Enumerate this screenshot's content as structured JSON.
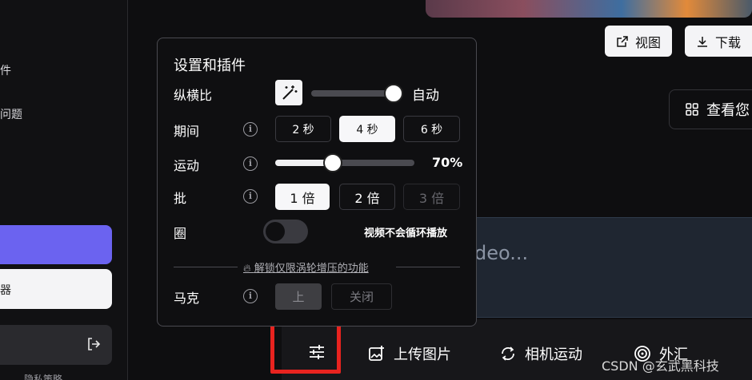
{
  "sidebar": {
    "item_a": "件",
    "item_b": "问题",
    "white_button": "器",
    "footer": "隐私策略"
  },
  "toolbar": {
    "view_label": "视图",
    "download_label": "下载",
    "gallery_label": "查看您"
  },
  "prompt": {
    "placeholder_tail": "deo..."
  },
  "settings": {
    "title": "设置和插件",
    "aspect": {
      "label": "纵横比",
      "value": "自动",
      "level": 1.0
    },
    "duration": {
      "label": "期间",
      "options": [
        "2 秒",
        "4 秒",
        "6 秒"
      ],
      "selected": "4 秒"
    },
    "motion": {
      "label": "运动",
      "value": "70%",
      "level": 0.7
    },
    "batch": {
      "label": "批",
      "options": [
        "1 倍",
        "2 倍",
        "3 倍"
      ],
      "selected": "1 倍",
      "disabled": "3 倍"
    },
    "loop": {
      "label": "圈",
      "note": "视频不会循环播放",
      "enabled": false
    },
    "unlock_text": "解锁仅限涡轮增压的功能",
    "watermark": {
      "label": "马克",
      "on": "上",
      "off": "关闭"
    }
  },
  "bottom_bar": {
    "upload": "上传图片",
    "camera": "相机运动",
    "extra": "外汇"
  },
  "overlay": {
    "highlight_color": "#e8231f",
    "csdn_watermark": "CSDN @玄武黑科技"
  },
  "colors": {
    "accent": "#6b63f0",
    "panel_bg": "#0f0f11"
  }
}
